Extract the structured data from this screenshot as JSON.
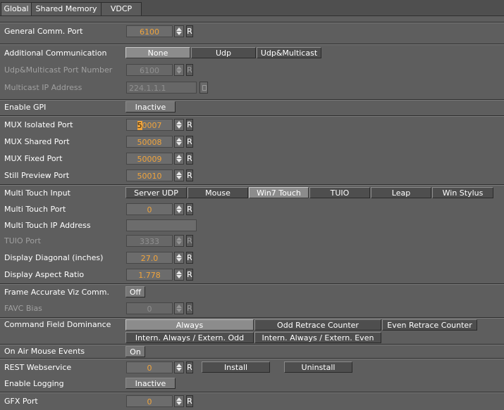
{
  "tabs": [
    {
      "label": "Global"
    },
    {
      "label": "Shared Memory"
    },
    {
      "label": "VDCP"
    }
  ],
  "general_comm_port": {
    "label": "General Comm. Port",
    "value": "6100"
  },
  "additional_comm": {
    "label": "Additional Communication",
    "options": [
      "None",
      "Udp",
      "Udp&Multicast"
    ],
    "selected": "None"
  },
  "udp_multicast_port": {
    "label": "Udp&Multicast Port Number",
    "value": "6100"
  },
  "multicast_ip": {
    "label": "Multicast IP Address",
    "value": "224.1.1.1"
  },
  "enable_gpi": {
    "label": "Enable GPI",
    "value": "Inactive"
  },
  "mux_isolated": {
    "label": "MUX Isolated Port",
    "value_sel": "5",
    "value_rest": "0007"
  },
  "mux_shared": {
    "label": "MUX Shared Port",
    "value": "50008"
  },
  "mux_fixed": {
    "label": "MUX Fixed Port",
    "value": "50009"
  },
  "still_preview": {
    "label": "Still Preview Port",
    "value": "50010"
  },
  "multi_touch_input": {
    "label": "Multi Touch Input",
    "options": [
      "Server UDP",
      "Mouse",
      "Win7 Touch",
      "TUIO",
      "Leap",
      "Win Stylus"
    ],
    "selected": "Win7 Touch"
  },
  "multi_touch_port": {
    "label": "Multi Touch Port",
    "value": "0"
  },
  "multi_touch_ip": {
    "label": "Multi Touch IP Address",
    "value": ""
  },
  "tuio_port": {
    "label": "TUIO Port",
    "value": "3333"
  },
  "display_diagonal": {
    "label": "Display Diagonal (inches)",
    "value": "27.0"
  },
  "display_aspect": {
    "label": "Display Aspect Ratio",
    "value": "1.778"
  },
  "frame_accurate": {
    "label": "Frame Accurate Viz Comm.",
    "value": "Off"
  },
  "favc_bias": {
    "label": "FAVC Bias",
    "value": "0"
  },
  "command_field": {
    "label": "Command Field Dominance",
    "options": [
      "Always",
      "Odd Retrace Counter",
      "Even Retrace Counter",
      "Intern. Always / Extern. Odd",
      "Intern. Always / Extern. Even"
    ],
    "selected": "Always"
  },
  "on_air_mouse": {
    "label": "On Air Mouse Events",
    "value": "On"
  },
  "rest_webservice": {
    "label": "REST Webservice",
    "value": "0",
    "install": "Install",
    "uninstall": "Uninstall"
  },
  "enable_logging": {
    "label": "Enable Logging",
    "value": "Inactive"
  },
  "gfx_port": {
    "label": "GFX Port",
    "value": "0"
  },
  "reset_label": "R"
}
